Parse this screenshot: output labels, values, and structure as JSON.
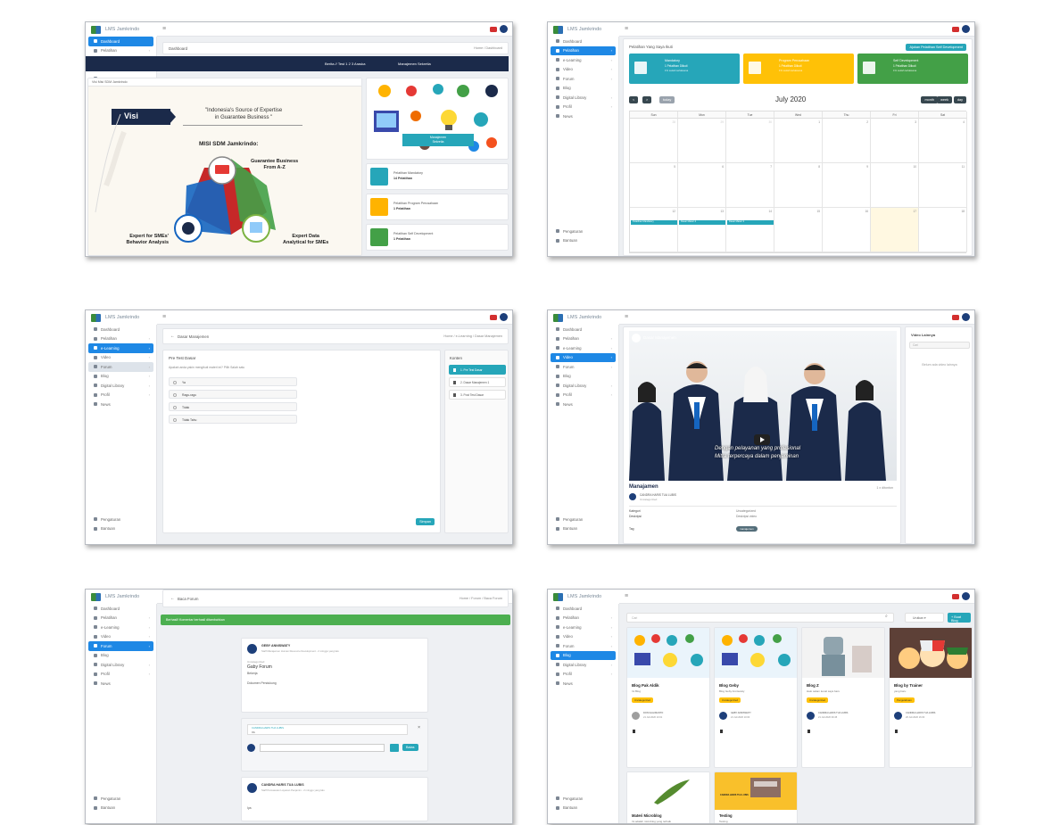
{
  "app": {
    "name": "LMS Jamkrindo"
  },
  "sidebar": {
    "items": [
      "Dashboard",
      "Pelatihan",
      "e-Learning",
      "Video",
      "Forum",
      "Blog",
      "Digital Library",
      "Profil",
      "News"
    ],
    "bottom": [
      "Pengaturan",
      "Bantuan"
    ]
  },
  "s1": {
    "crumb": "Dashboard",
    "crumb_right": "Home / Dashboard",
    "ticker_left": "Berita // Test 1 2 3 Araska",
    "ticker_right": "Manajemen Sekretia",
    "panel_title": "Visi Misi SDM Jamkrindo",
    "visi_label": "Visi",
    "visi_text_1": "\"Indonesia's Source of Expertise",
    "visi_text_2": "in Guarantee Business \"",
    "misi_title": "MISI SDM Jamkrindo:",
    "misi_1a": "Guarantee Business",
    "misi_1b": "From A-Z",
    "misi_2a": "Expert for SMEs'",
    "misi_2b": "Behavior Analysis",
    "misi_3a": "Expert Data",
    "misi_3b": "Analytical for SMEs",
    "illus_caption_1": "Manajemen",
    "illus_caption_2": "Sekretia",
    "list": [
      {
        "title": "Pelatihan Mandatory",
        "count": "14 Pelatihan",
        "color": "#26a6b9"
      },
      {
        "title": "Pelatihan Program Perusahaan",
        "count": "1 Pelatihan",
        "color": "#ffb300"
      },
      {
        "title": "Pelatihan Self Development",
        "count": "1 Pelatihan",
        "color": "#43a047"
      }
    ]
  },
  "s2": {
    "crumb": "Pelatihan Yang Saya Ikuti",
    "add_btn": "Ajukan Pelatihan Self Development",
    "tiles": [
      {
        "title": "Mandatory",
        "line1": "1 Pelatihan Diikuti",
        "line2": "1% sudah terlaksana",
        "color": "#26a6b9"
      },
      {
        "title": "Program Perusahaan",
        "line1": "1 Pelatihan Diikuti",
        "line2": "1% sudah terlaksana",
        "color": "#ffc107"
      },
      {
        "title": "Self Development",
        "line1": "1 Pelatihan Diikuti",
        "line2": "1% sudah terlaksana",
        "color": "#43a047"
      }
    ],
    "month": "July 2020",
    "prev": "<",
    "next": ">",
    "today": "today",
    "views": [
      "month",
      "week",
      "day"
    ],
    "weekdays": [
      "Sun",
      "Mon",
      "Tue",
      "Wed",
      "Thu",
      "Fri",
      "Sat"
    ],
    "week1": [
      "28",
      "29",
      "30",
      "1",
      "2",
      "3",
      "4"
    ],
    "week2": [
      "5",
      "6",
      "7",
      "8",
      "9",
      "10",
      "11"
    ],
    "week3": [
      "12",
      "13",
      "14",
      "15",
      "16",
      "17",
      "18"
    ],
    "events": [
      "Pelatihan Mandatory",
      "Dasar Materi 2",
      "Dasar Materi 3"
    ]
  },
  "s3": {
    "crumb": "Dasar Manajemen",
    "crumb_right": "Home / e-Learning / Dasar Manajemen",
    "quiz_title": "Pre Test Dasar",
    "question": "Apakah anda yakin mengikuti materi ini? Pilih Salah satu",
    "options": [
      "Ya",
      "Ragu-ragu",
      "Tidak",
      "Tidak Tahu"
    ],
    "submit": "Simpan",
    "konten_title": "Konten",
    "konten": [
      "1. Pre Test Dasar",
      "2. Dasar Manajemen 1",
      "3. Post Test Dasar"
    ]
  },
  "s4": {
    "video_title": "Dasar Manajemen",
    "overlay_1": "Dengan pelayanan yang profesional",
    "overlay_2": "Mitra terpercaya dalam penjaminan",
    "title": "Manajamen",
    "views": "1 x ditonton",
    "author": "CANDRA HARIS TUA LUBIS",
    "author_sub": "Uncategorized",
    "meta_1k": "Kategori",
    "meta_1v": "Uncategorized",
    "meta_2k": "Deskripsi",
    "meta_2v": "Deskripsi video",
    "meta_3k": "Tag",
    "meta_3v": "manajemen",
    "side_title": "Video Lainnya",
    "side_search": "Cari",
    "side_empty": "Belum ada video lainnya"
  },
  "s5": {
    "crumb": "Baca Forum",
    "crumb_right": "Home / Forum / Baca Forum",
    "alert": "Berhasil! Komentar berhasil ditambahkan",
    "post_author": "GEBY ANNISWATY",
    "post_meta": "Staff Manajemen Human Resource Development - 2 minggu yang lalu",
    "post_cat": "Uncategorized",
    "post_title": "Gaby Forum",
    "post_body_1": "Bekerja",
    "post_body_2": "Dokumen Pendukung",
    "reply_name": "CANDRA HARIS TUA LUBIS",
    "reply_text": "Ok",
    "reply_btn": "Balas",
    "c2_author": "CANDRA HARIS TUA LUBIS",
    "c2_meta": "Staff Pemasaran Layanan Penjamin - 2 minggu yang lalu",
    "c2_body": "Iya"
  },
  "s6": {
    "search": "Cari",
    "filter": "Urutkan",
    "add_btn": "+ Buat Blog",
    "blogs": [
      {
        "title": "Blog Pak Aldik",
        "sub": "Ini Blog",
        "tag": "Uncategorized",
        "author": "DONI HALIMANTO",
        "date": "21 Juli 2020 10:01"
      },
      {
        "title": "Blog Geby",
        "sub": "Blog Geby Anniswaty",
        "tag": "Uncategorized",
        "author": "GEBY ANNISWATY",
        "date": "21 Juli 2020 10:00"
      },
      {
        "title": "Blog Z",
        "sub": "Halo salam kenal saya baru",
        "tag": "Uncategorized",
        "author": "CANDRA HARIS TUA LUBIS",
        "date": "21 Juli 2020 09:45"
      },
      {
        "title": "Blog by Trainer",
        "sub": "yang baru",
        "tag": "Pengetahuan",
        "author": "CANDRA HARIS TUA LUBIS",
        "date": "20 Juli 2020 16:00"
      }
    ],
    "blogs2": [
      {
        "title": "Materi Microblog",
        "sub": "Ini adalah microblog yang terbaik"
      },
      {
        "title": "Testing",
        "sub": "Testing"
      }
    ],
    "banner": "CANDRA HARIS TUA LUBIS"
  }
}
